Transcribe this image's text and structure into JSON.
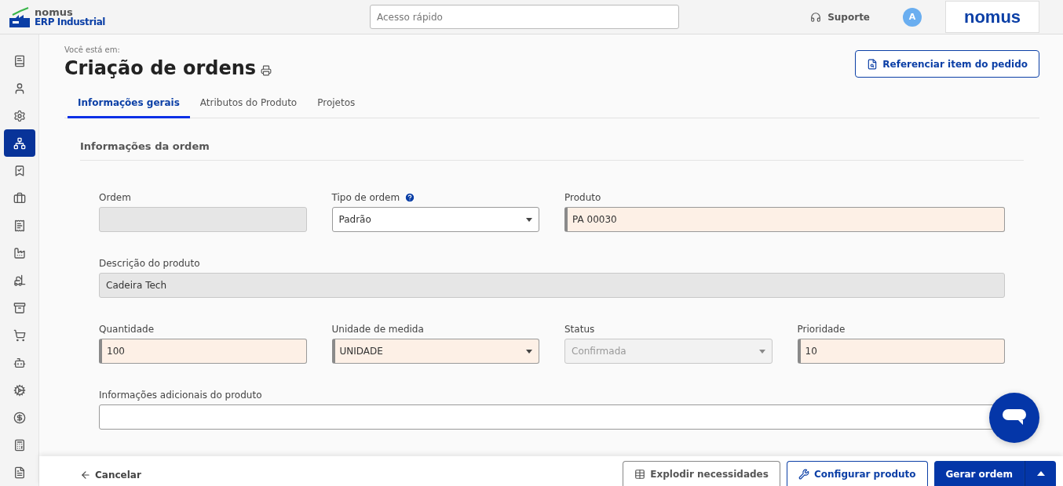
{
  "header": {
    "logo_brand": "nomus",
    "logo_product": "ERP Industrial",
    "search": {
      "placeholder": "Acesso rápido"
    },
    "support": "Suporte",
    "avatar": "A",
    "brand_logo": "nomus"
  },
  "sidebar": {
    "items": [
      {
        "selected": false
      },
      {
        "selected": false
      },
      {
        "selected": false
      },
      {
        "selected": true
      },
      {
        "selected": false
      },
      {
        "selected": false
      },
      {
        "selected": false
      },
      {
        "selected": false
      },
      {
        "selected": false
      },
      {
        "selected": false
      },
      {
        "selected": false
      },
      {
        "selected": false
      },
      {
        "selected": false
      },
      {
        "selected": false
      },
      {
        "selected": false
      },
      {
        "selected": false
      }
    ]
  },
  "breadcrumb": "Você está em:",
  "title": "Criação de ordens",
  "reference_button": "Referenciar item do pedido",
  "tabs": [
    {
      "label": "Informações gerais",
      "selected": true
    },
    {
      "label": "Atributos do Produto",
      "selected": false
    },
    {
      "label": "Projetos",
      "selected": false
    }
  ],
  "section": {
    "title": "Informações da ordem",
    "rows": [
      [
        {
          "label": "Ordem",
          "kind": "text",
          "required": false,
          "disabled": true,
          "help": false
        },
        {
          "label": "Tipo de ordem",
          "kind": "select",
          "value": "Padrão",
          "required": false,
          "disabled": false,
          "help": true
        },
        {
          "label": "Produto",
          "kind": "text",
          "value": "PA 00030",
          "required": true,
          "disabled": false,
          "help": false
        }
      ],
      [
        {
          "label": "Descrição do produto",
          "kind": "text",
          "value": "Cadeira Tech",
          "required": false,
          "disabled": true,
          "help": false
        }
      ],
      [
        {
          "label": "Quantidade",
          "kind": "text",
          "value": "100",
          "required": true,
          "disabled": false,
          "help": false
        },
        {
          "label": "Unidade de medida",
          "kind": "select",
          "value": "UNIDADE",
          "required": true,
          "disabled": false,
          "help": false
        },
        {
          "label": "Status",
          "kind": "select",
          "value": "Confirmada",
          "required": false,
          "disabled": true,
          "help": false
        },
        {
          "label": "Prioridade",
          "kind": "text",
          "value": "10",
          "required": true,
          "disabled": false,
          "help": false
        }
      ],
      [
        {
          "label": "Informações adicionais do produto",
          "kind": "text",
          "required": false,
          "disabled": false,
          "help": false
        }
      ]
    ]
  },
  "footer": {
    "cancel": "Cancelar",
    "buttons": [
      {
        "label": "Explodir necessidades",
        "kind": "outline"
      },
      {
        "label": "Configurar produto",
        "kind": "outline-primary"
      },
      {
        "label": "Gerar ordem",
        "kind": "primary-split"
      }
    ]
  }
}
